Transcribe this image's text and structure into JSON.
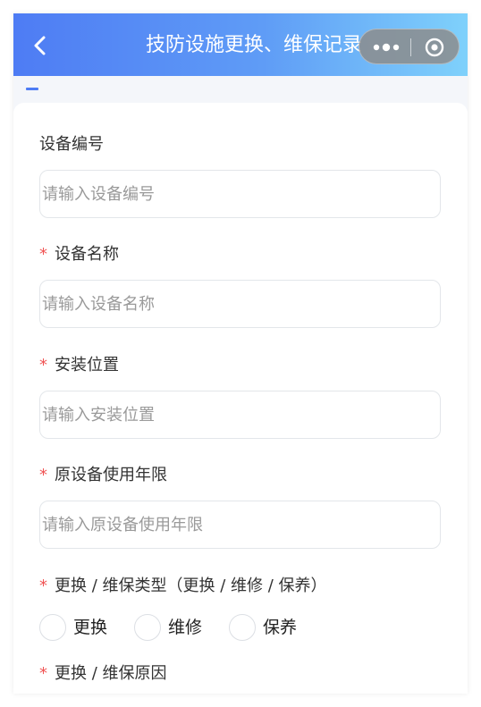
{
  "header": {
    "title": "技防设施更换、维保记录",
    "back_icon": "chevron-left-icon",
    "menu_icon": "more-dots-icon",
    "close_icon": "target-close-icon",
    "gradient_start": "#4e7cf4",
    "gradient_end": "#7fd1fb"
  },
  "form": {
    "required_mark": "*",
    "device_no": {
      "label": "设备编号",
      "placeholder": "请输入设备编号"
    },
    "device_name": {
      "label": "设备名称",
      "placeholder": "请输入设备名称"
    },
    "install_location": {
      "label": "安装位置",
      "placeholder": "请输入安装位置"
    },
    "service_life": {
      "label": "原设备使用年限",
      "placeholder": "请输入原设备使用年限"
    },
    "type": {
      "label": "更换 / 维保类型（更换 / 维修 / 保养）",
      "options": [
        "更换",
        "维修",
        "保养"
      ]
    },
    "reason": {
      "label": "更换 / 维保原因"
    }
  },
  "colors": {
    "accent": "#4e7cf4",
    "required": "#f05454"
  }
}
